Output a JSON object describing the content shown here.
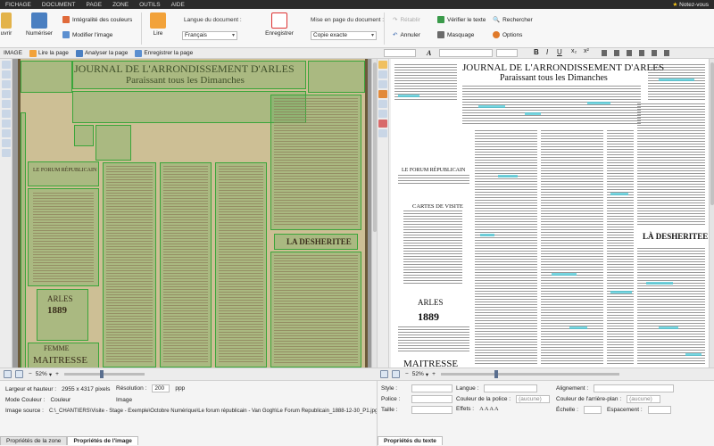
{
  "menu": {
    "items": [
      "FICHAGE",
      "DOCUMENT",
      "PAGE",
      "ZONE",
      "OUTILS",
      "AIDE"
    ],
    "notez_vous": "Notez-vous"
  },
  "ribbon": {
    "ouvrir": "uvrir",
    "numeriser": "Numériser",
    "integralite": "Intégralité des couleurs",
    "modifier_image": "Modifier l'image",
    "lire": "Lire",
    "langue_label": "Langue du document :",
    "langue_value": "Français",
    "enregistrer": "Enregistrer",
    "mise_en_page_label": "Mise en page du document :",
    "mise_en_page_value": "Copie exacte",
    "retablir": "Rétablir",
    "annuler": "Annuler",
    "verifier": "Vérifier le texte",
    "masquage": "Masquage",
    "rechercher": "Rechercher",
    "options": "Options"
  },
  "image_toolbar": {
    "label": "IMAGE",
    "lire_page": "Lire la page",
    "analyser_page": "Analyser la page",
    "enregistrer_page": "Enregistrer la page"
  },
  "image_zones": {
    "journal_title": "JOURNAL DE L'ARRONDISSEMENT D'ARLES",
    "journal_subtitle": "Paraissant tous les Dimanches",
    "forum": "LE FORUM RÉPUBLICAIN",
    "arles": "ARLES",
    "year": "1889",
    "desheritee": "LA DESHERITEE",
    "femme": "FEMME",
    "maitresse": "MAITRESSE"
  },
  "text_page": {
    "title": "JOURNAL DE L'ARRONDISSEMENT D'ARLES",
    "subtitle": "Paraissant tous les Dimanches",
    "forum": "LE FORUM RÉPUBLICAIN",
    "cartes": "CARTES DE VISITE",
    "arles": "ARLES",
    "year": "1889",
    "desheritee": "LÀ DESHERITEE",
    "maitresse": "MAITRESSE"
  },
  "zoom": {
    "left": "52%",
    "right": "52%"
  },
  "image_props": {
    "size_label": "Largeur et hauteur :",
    "size_value": "2955 x 4317 pixels",
    "resolution_label": "Résolution :",
    "resolution_value": "200",
    "resolution_unit": "ppp",
    "color_mode_label": "Mode Couleur :",
    "color_mode_value": "Couleur",
    "image_label": "Image",
    "source_label": "Image source :",
    "source_value": "C:\\_CHANTIERS\\Visite - Stage - Exemple\\Octobre Numérique\\Le forum républicain - Van Gogh\\Le Forum Republicain_1888-12-30_P1.jpg",
    "tab_zone": "Propriétés de la zone",
    "tab_image": "Propriétés de l'image"
  },
  "text_props": {
    "style_label": "Style :",
    "police_label": "Police :",
    "taille_label": "Taille :",
    "langue_label": "Langue :",
    "couleur_police_label": "Couleur de la police :",
    "couleur_police_value": "(aucune)",
    "effets_label": "Effets :",
    "alignement_label": "Alignement :",
    "couleur_arriere_label": "Couleur de l'arrière-plan :",
    "couleur_arriere_value": "(aucune)",
    "echelle_label": "Échelle :",
    "espacement_label": "Espacement :",
    "tab_texte": "Propriétés du texte"
  }
}
